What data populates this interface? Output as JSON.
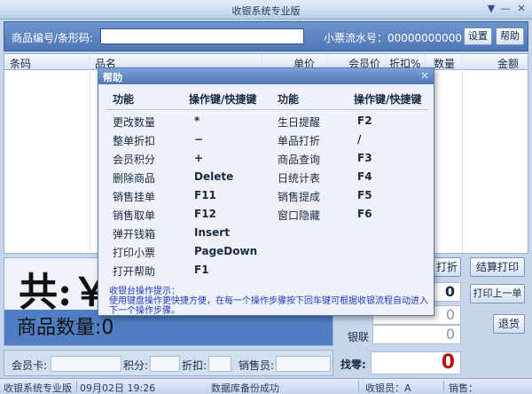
{
  "window": {
    "title": "收银系统专业版",
    "controls": [
      "▼",
      "—",
      "✕"
    ]
  },
  "search": {
    "label": "商品编号/条形码:",
    "value": "",
    "receipt_label": "小票流水号：00000000000",
    "settings_label": "设置",
    "help_label": "帮助"
  },
  "table": {
    "headers": [
      "条码",
      "品名",
      "单价",
      "会员价",
      "折扣%",
      "数量",
      "金额"
    ]
  },
  "totals": {
    "big_prefix": "共:￥",
    "qty_text": "商品数量:0"
  },
  "pay": {
    "discount_btn": "打折",
    "settle_btn": "结算打印",
    "reprint_btn": "打印上一单",
    "return_btn": "退货",
    "received_value": "0",
    "card_value": "0",
    "unionpay_label": "银联",
    "unionpay_value": "0",
    "change_label": "找零:",
    "change_value": "0"
  },
  "member": {
    "card_label": "会员卡:",
    "points_label": "积分:",
    "discount_label": "折扣:",
    "clerk_label": "销售员:"
  },
  "status": {
    "app": "收银系统专业版",
    "datetime": "09月02日 19:26",
    "backup": "数据库备份成功",
    "cashier": "收银员：A",
    "salesperson": "销售："
  },
  "help": {
    "title": "帮助",
    "close": "×",
    "col1_header": "功能",
    "col2_header": "操作键/快捷键",
    "col3_header": "功能",
    "col4_header": "操作键/快捷键",
    "left_items": [
      {
        "func": "更改数量",
        "key": "*"
      },
      {
        "func": "整单折扣",
        "key": "−"
      },
      {
        "func": "会员积分",
        "key": "+"
      },
      {
        "func": "删除商品",
        "key": "Delete"
      },
      {
        "func": "销售挂单",
        "key": "F11"
      },
      {
        "func": "销售取单",
        "key": "F12"
      },
      {
        "func": "弹开钱箱",
        "key": "Insert"
      },
      {
        "func": "打印小票",
        "key": "PageDown"
      },
      {
        "func": "打开帮助",
        "key": "F1"
      }
    ],
    "right_items": [
      {
        "func": "生日提醒",
        "key": "F2"
      },
      {
        "func": "单品打折",
        "key": "/"
      },
      {
        "func": "商品查询",
        "key": "F3"
      },
      {
        "func": "日统计表",
        "key": "F4"
      },
      {
        "func": "销售提成",
        "key": "F5"
      },
      {
        "func": "窗口隐藏",
        "key": "F6"
      }
    ],
    "tip_title": "收银台操作提示：",
    "tip_body": "使用键盘操作更快捷方便，在每一个操作步骤按下回车键可根据收银流程自动进入下一个操作步骤。"
  }
}
